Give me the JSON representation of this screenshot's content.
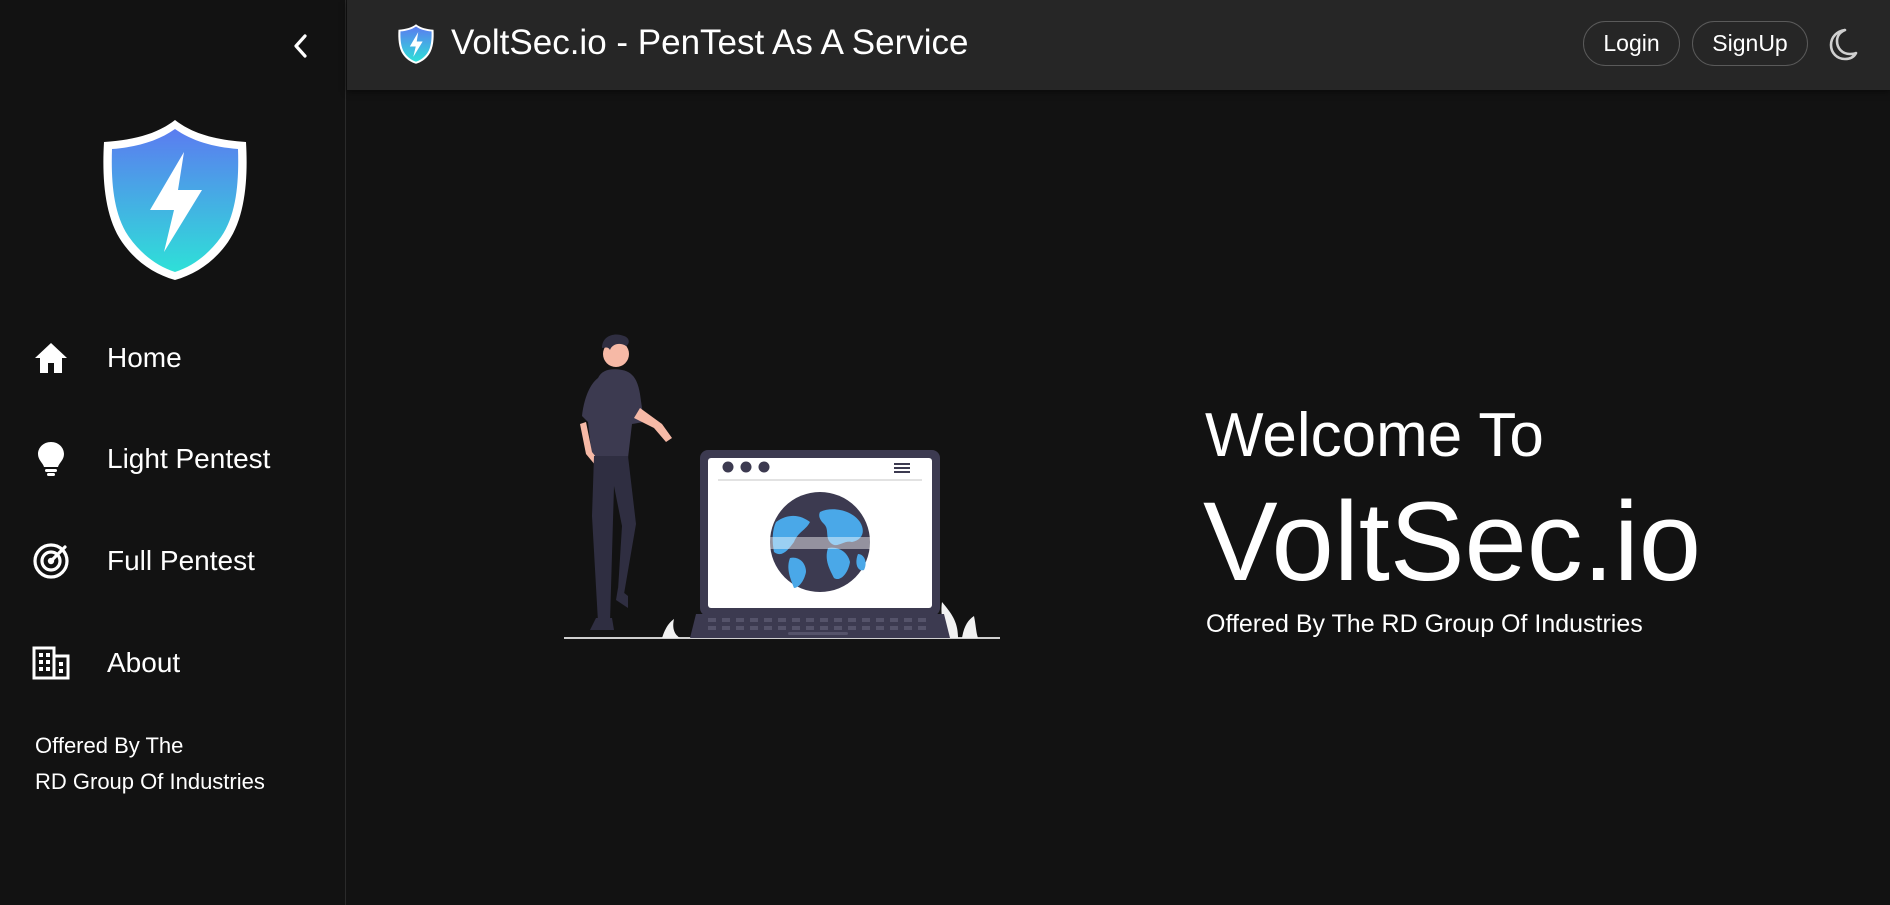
{
  "app": {
    "title": "VoltSec.io - PenTest As A Service"
  },
  "colors": {
    "background": "#121212",
    "topbar": "#262626",
    "text": "#ffffff",
    "shield_gradient_top": "#5b7cf0",
    "shield_gradient_bottom": "#2ee0d8",
    "globe_blue": "#4aa8e8",
    "figure_dark": "#3c3a50"
  },
  "header": {
    "login_label": "Login",
    "signup_label": "SignUp",
    "theme_icon": "moon-icon"
  },
  "sidebar": {
    "collapse_icon": "chevron-left-icon",
    "items": [
      {
        "label": "Home",
        "icon": "home-icon"
      },
      {
        "label": "Light Pentest",
        "icon": "lightbulb-icon"
      },
      {
        "label": "Full Pentest",
        "icon": "radar-icon"
      },
      {
        "label": "About",
        "icon": "building-icon"
      }
    ],
    "footer_line1": "Offered By The",
    "footer_line2": "RD Group Of Industries"
  },
  "hero": {
    "welcome": "Welcome To",
    "brand": "VoltSec.io",
    "offered": "Offered By The RD Group Of Industries"
  }
}
